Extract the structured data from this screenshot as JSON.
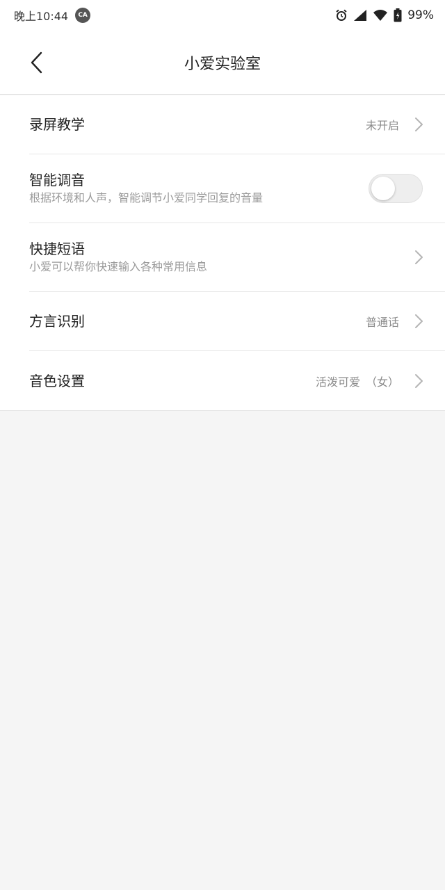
{
  "status_bar": {
    "time": "晚上10:44",
    "badge": "CA",
    "battery": "99%",
    "icons": [
      "alarm-icon",
      "signal-icon",
      "wifi-icon",
      "battery-icon"
    ]
  },
  "header": {
    "title": "小爱实验室"
  },
  "settings": [
    {
      "title": "录屏教学",
      "subtitle": "",
      "value": "未开启",
      "control": "chevron"
    },
    {
      "title": "智能调音",
      "subtitle": "根据环境和人声，智能调节小爱同学回复的音量",
      "value": "",
      "control": "toggle",
      "toggle_on": false
    },
    {
      "title": "快捷短语",
      "subtitle": "小爱可以帮你快速输入各种常用信息",
      "value": "",
      "control": "chevron"
    },
    {
      "title": "方言识别",
      "subtitle": "",
      "value": "普通话",
      "control": "chevron"
    },
    {
      "title": "音色设置",
      "subtitle": "",
      "value": "活泼可爱　（女）",
      "control": "chevron"
    }
  ],
  "colors": {
    "background": "#f5f5f5",
    "surface": "#ffffff",
    "divider": "#e6e6e6",
    "secondary_text": "#9a9a9a"
  }
}
